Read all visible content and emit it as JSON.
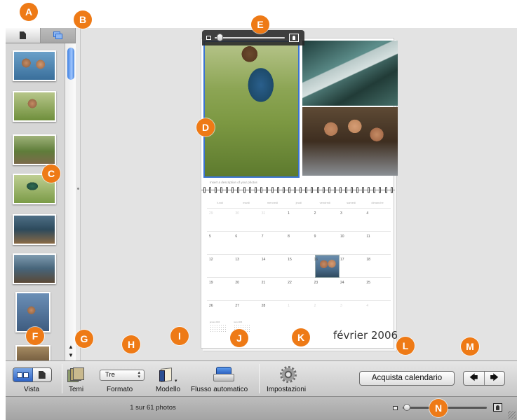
{
  "callouts": [
    "A",
    "B",
    "C",
    "D",
    "E",
    "F",
    "G",
    "H",
    "I",
    "J",
    "K",
    "L",
    "M",
    "N"
  ],
  "calendar": {
    "description_placeholder": "Insert a description of your photos",
    "weekdays": [
      "lundi",
      "mardi",
      "mercredi",
      "jeudi",
      "vendredi",
      "samedi",
      "dimanche"
    ],
    "weeks": [
      [
        "29",
        "30",
        "31",
        "1",
        "2",
        "3",
        "4"
      ],
      [
        "5",
        "6",
        "7",
        "8",
        "9",
        "10",
        "11"
      ],
      [
        "12",
        "13",
        "14",
        "15",
        "16",
        "17",
        "18"
      ],
      [
        "19",
        "20",
        "21",
        "22",
        "23",
        "24",
        "25"
      ],
      [
        "26",
        "27",
        "28",
        "1",
        "2",
        "3",
        "4"
      ]
    ],
    "dim_cells": [
      [
        0,
        0
      ],
      [
        0,
        1
      ],
      [
        0,
        2
      ],
      [
        4,
        3
      ],
      [
        4,
        4
      ],
      [
        4,
        5
      ],
      [
        4,
        6
      ]
    ],
    "photo_day": [
      2,
      4
    ],
    "mini_prev": "janvier 2006",
    "mini_next": "mars 2006",
    "month_title": "février 2006"
  },
  "toolbar": {
    "view_label": "Vista",
    "themes_label": "Temi",
    "format_value": "Tre",
    "format_label": "Formato",
    "layout_label": "Modello",
    "autoflow_label": "Flusso automatico",
    "settings_label": "Impostazioni",
    "buy_label": "Acquista calendario",
    "prev_arrow": "🡄",
    "next_arrow": "🡆"
  },
  "status": {
    "photo_count": "1 sur 61 photos",
    "thumbnail_size": 0.05
  },
  "zoom": {
    "value": 0.05
  },
  "colors": {
    "callout": "#ee7a16",
    "selection": "#3b73d1"
  }
}
